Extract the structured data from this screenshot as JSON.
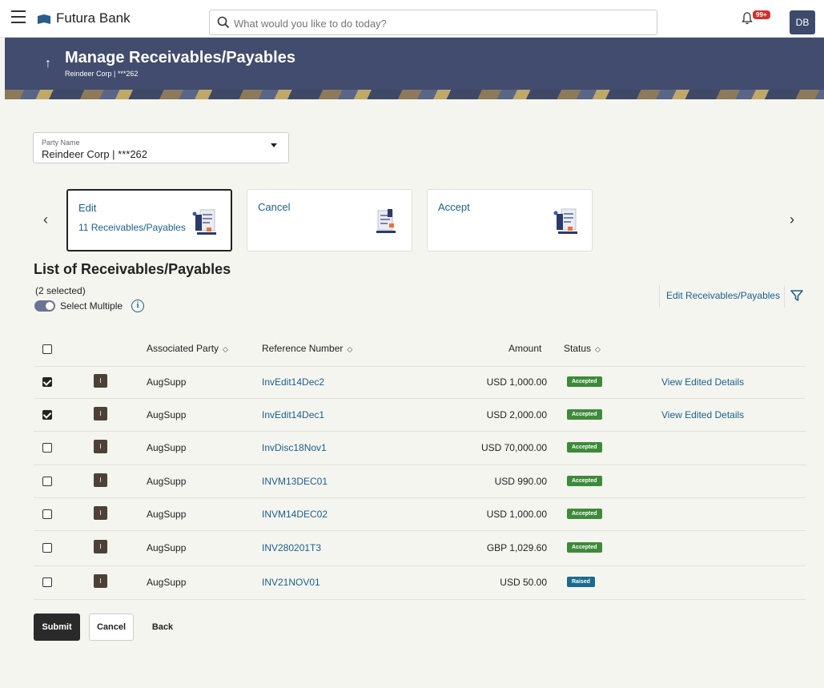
{
  "app": {
    "brand": "Futura Bank",
    "search_placeholder": "What would you like to do today?",
    "notification_count": "99+",
    "user_initials": "DB"
  },
  "header": {
    "title": "Manage Receivables/Payables",
    "subtitle": "Reindeer Corp | ***262"
  },
  "party": {
    "label": "Party Name",
    "value": "Reindeer Corp | ***262"
  },
  "cards": [
    {
      "title": "Edit",
      "subtitle": "11 Receivables/Payables",
      "active": true
    },
    {
      "title": "Cancel",
      "subtitle": "",
      "active": false
    },
    {
      "title": "Accept",
      "subtitle": "",
      "active": false
    }
  ],
  "list": {
    "title": "List of Receivables/Payables",
    "selected_count": "(2 selected)",
    "select_multiple_label": "Select Multiple",
    "edit_link": "Edit Receivables/Payables",
    "columns": {
      "party": "Associated Party",
      "reference": "Reference Number",
      "amount": "Amount",
      "status": "Status"
    },
    "rows": [
      {
        "checked": true,
        "icon": "I",
        "party": "AugSupp",
        "reference": "InvEdit14Dec2",
        "amount": "USD 1,000.00",
        "status": "Accepted",
        "action": "View Edited Details"
      },
      {
        "checked": true,
        "icon": "I",
        "party": "AugSupp",
        "reference": "InvEdit14Dec1",
        "amount": "USD 2,000.00",
        "status": "Accepted",
        "action": "View Edited Details"
      },
      {
        "checked": false,
        "icon": "I",
        "party": "AugSupp",
        "reference": "InvDisc18Nov1",
        "amount": "USD 70,000.00",
        "status": "Accepted",
        "action": ""
      },
      {
        "checked": false,
        "icon": "I",
        "party": "AugSupp",
        "reference": "INVM13DEC01",
        "amount": "USD 990.00",
        "status": "Accepted",
        "action": ""
      },
      {
        "checked": false,
        "icon": "I",
        "party": "AugSupp",
        "reference": "INVM14DEC02",
        "amount": "USD 1,000.00",
        "status": "Accepted",
        "action": ""
      },
      {
        "checked": false,
        "icon": "I",
        "party": "AugSupp",
        "reference": "INV280201T3",
        "amount": "GBP 1,029.60",
        "status": "Accepted",
        "action": ""
      },
      {
        "checked": false,
        "icon": "I",
        "party": "AugSupp",
        "reference": "INV21NOV01",
        "amount": "USD 50.00",
        "status": "Raised",
        "action": ""
      }
    ]
  },
  "buttons": {
    "submit": "Submit",
    "cancel": "Cancel",
    "back": "Back"
  },
  "colors": {
    "header_bg": "#424c6e",
    "link": "#1a5f8c",
    "accepted": "#3d8a3a",
    "raised": "#1c6b8e"
  }
}
